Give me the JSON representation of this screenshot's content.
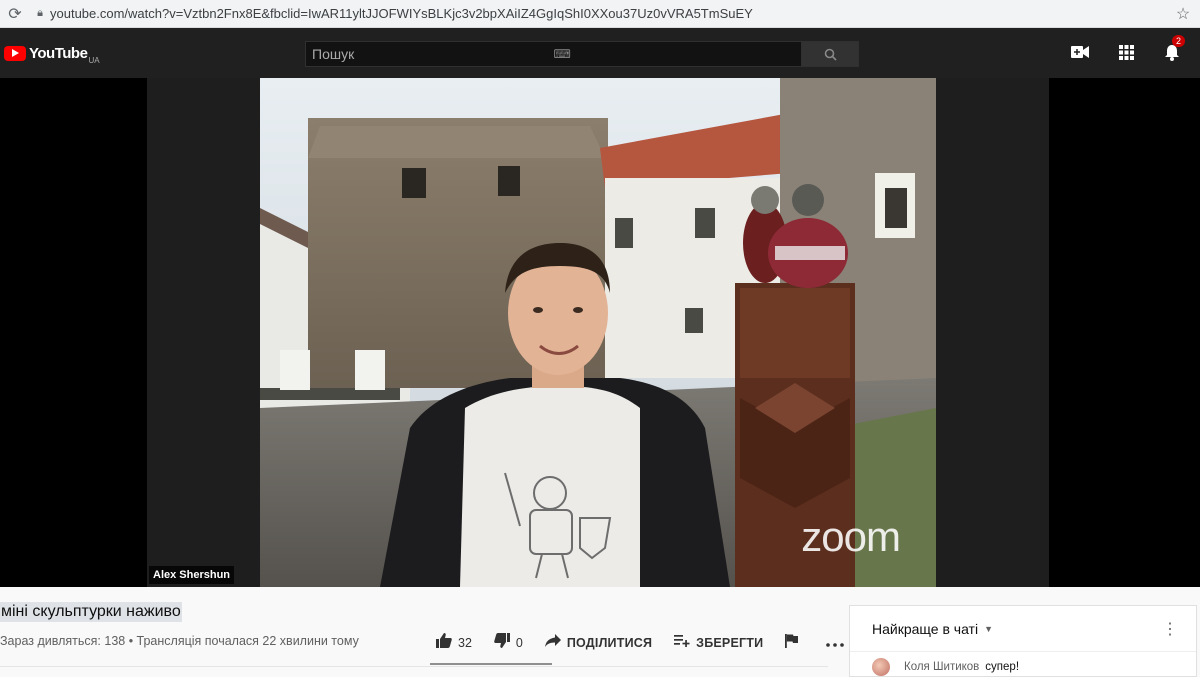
{
  "browser": {
    "url": "youtube.com/watch?v=Vztbn2Fnx8E&fbclid=IwAR11yltJJOFWIYsBLKjc3v2bpXAiIZ4GgIqShI0XXou37Uz0vVRA5TmSuEY"
  },
  "masthead": {
    "logo_text": "YouTube",
    "country_code": "UA",
    "search_placeholder": "Пошук",
    "notifications_count": "2"
  },
  "player": {
    "participant_name": "Alex Shershun",
    "watermark": "zoom"
  },
  "video": {
    "title": "міні скульптурки наживо",
    "meta": "Зараз дивляться: 138 • Трансляція почалася 22 хвилини тому"
  },
  "actions": {
    "likes": "32",
    "dislikes": "0",
    "share_label": "ПОДІЛИТИСЯ",
    "save_label": "ЗБЕРЕГТИ"
  },
  "chat": {
    "header_title": "Найкраще в чаті",
    "messages": [
      {
        "author": "Коля Шитиков",
        "text": "супер!"
      }
    ]
  },
  "colors": {
    "brand_red": "#ff0000",
    "masthead_bg": "#202020",
    "badge_red": "#cc0000"
  }
}
